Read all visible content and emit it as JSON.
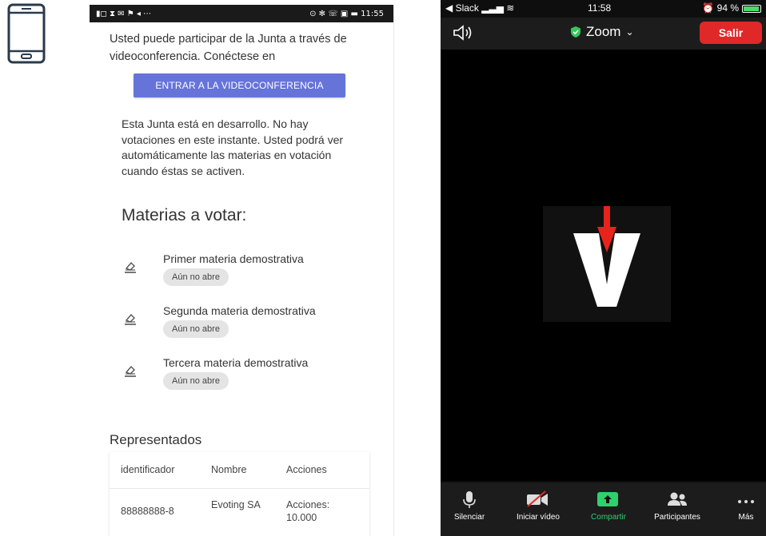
{
  "left_phone": {
    "status_time": "11:55",
    "intro_text": "Usted puede participar de la Junta a través de videoconferencia. Conéctese en",
    "videoconference_button": "ENTRAR A LA VIDEOCONFERENCIA",
    "notice_text": "Esta Junta está en desarrollo. No hay votaciones en este instante. Usted podrá ver automáticamente las materias en votación cuando éstas se activen.",
    "matters_heading": "Materias a votar:",
    "matters": [
      {
        "title": "Primer materia demostrativa",
        "status": "Aún no abre"
      },
      {
        "title": "Segunda materia demostrativa",
        "status": "Aún no abre"
      },
      {
        "title": "Tercera materia demostrativa",
        "status": "Aún no abre"
      }
    ],
    "represented_heading": "Representados",
    "table": {
      "headers": [
        "identificador",
        "Nombre",
        "Acciones"
      ],
      "rows": [
        {
          "id": "88888888-8",
          "name": "Evoting SA",
          "shares": "Acciones: 10.000"
        }
      ]
    }
  },
  "zoom_phone": {
    "status": {
      "carrier": "Slack",
      "time": "11:58",
      "battery": "94 %",
      "battery_level": 0.94
    },
    "title": "Zoom",
    "leave_button": "Salir",
    "toolbar": [
      {
        "label": "Silenciar",
        "icon": "microphone-icon"
      },
      {
        "label": "Iniciar vídeo",
        "icon": "video-off-icon"
      },
      {
        "label": "Compartir",
        "icon": "share-screen-icon"
      },
      {
        "label": "Participantes",
        "icon": "participants-icon"
      },
      {
        "label": "Más",
        "icon": "more-icon"
      }
    ],
    "colors": {
      "leave": "#e02828",
      "share": "#2fd16c",
      "shield": "#32c85a",
      "logo_arrow": "#e8231b"
    }
  }
}
